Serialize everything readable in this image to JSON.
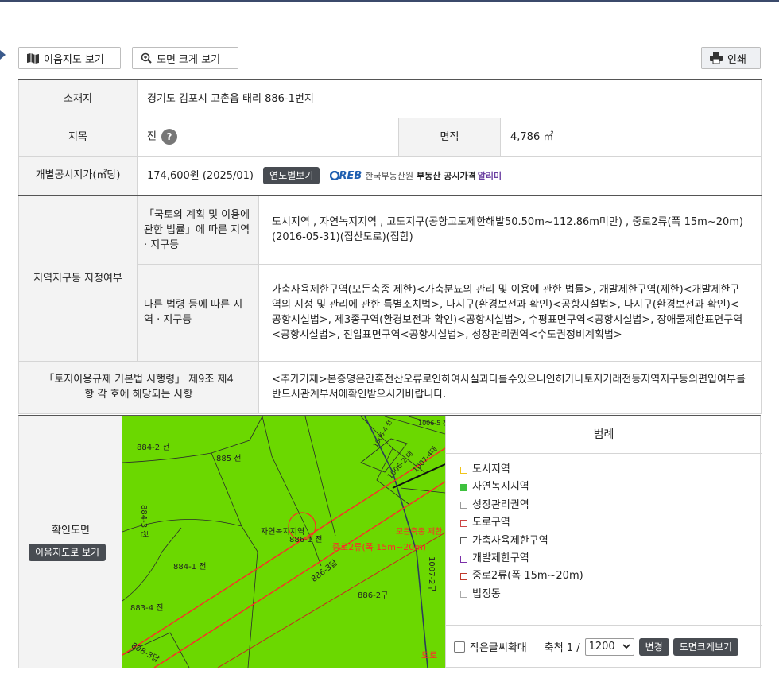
{
  "toolbar": {
    "land_use_map_label": "이음지도 보기",
    "enlarge_label": "도면 크게 보기",
    "print_label": "인쇄"
  },
  "info": {
    "location_label": "소재지",
    "location_value": "경기도 김포시 고촌읍 태리 886-1번지",
    "category_label": "지목",
    "category_value": "전",
    "help_glyph": "?",
    "area_label": "면적",
    "area_value": "4,786 ㎡",
    "price_label": "개별공시지가(㎡당)",
    "price_value": "174,600원 (2025/01)",
    "yearly_button": "연도별보기",
    "reb_logo": "REB",
    "reb_org": "한국부동산원",
    "reb_service": "부동산 공시가격",
    "reb_brand": "알리미"
  },
  "zoning": {
    "label": "지역지구등 지정여부",
    "national_law_label": "「국토의 계획 및 이용에 관한 법률」에 따른 지역 · 지구등",
    "national_law_value": "도시지역 , 자연녹지지역 , 고도지구(공항고도제한해발50.50m~112.86m미만) , 중로2류(폭 15m~20m)(2016-05-31)(집산도로)(접함)",
    "other_law_label": "다른 법령 등에 따른 지역 · 지구등",
    "other_law_value": "가축사육제한구역(모든축종 제한)<가축분뇨의 관리 및 이용에 관한 법률>, 개발제한구역(제한)<개발제한구역의 지정 및 관리에 관한 특별조치법>, 나지구(환경보전과 확인)<공항시설법>, 다지구(환경보전과 확인)<공항시설법>, 제3종구역(환경보전과 확인)<공항시설법>, 수평표면구역<공항시설법>, 장애물제한표면구역<공항시설법>, 진입표면구역<공항시설법>, 성장관리권역<수도권정비계획법>"
  },
  "regulation": {
    "label": "「토지이용규제 기본법 시행령」 제9조 제4항 각 호에 해당되는 사항",
    "value": "<추가기재>본증명은간혹전산오류로인하여사실과다를수있으니인허가나토지거래전등지역지구등의편입여부를반드시관계부서에확인받으시기바랍니다."
  },
  "map": {
    "label": "확인도면",
    "button": "이음지도로 보기",
    "parcels": [
      "884-2 전",
      "885 전",
      "884-3 전",
      "884-1 전",
      "883-4 전",
      "898-3답",
      "886-1 전",
      "886-3답",
      "886-2구",
      "1007-2구",
      "1006-4 천",
      "1006-2 대",
      "1007-4대",
      "1006-5 천"
    ],
    "overlay_label": "자연녹지지역",
    "road_label": "중로2류(폭 15m~20m)",
    "restriction_label": "모든축종 제한",
    "road_area_label": "도로"
  },
  "legend": {
    "title": "범례",
    "items": [
      {
        "label": "도시지역",
        "color": "#f0c419",
        "filled": false
      },
      {
        "label": "자연녹지지역",
        "color": "#3ec13e",
        "filled": true
      },
      {
        "label": "성장관리권역",
        "color": "#999999",
        "filled": false
      },
      {
        "label": "도로구역",
        "color": "#cc4444",
        "filled": false
      },
      {
        "label": "가축사육제한구역",
        "color": "#555555",
        "filled": false
      },
      {
        "label": "개발제한구역",
        "color": "#7b2fa8",
        "filled": false
      },
      {
        "label": "중로2류(폭 15m~20m)",
        "color": "#c0392b",
        "filled": false
      },
      {
        "label": "법정동",
        "color": "#aaaaaa",
        "filled": false
      }
    ]
  },
  "controls": {
    "small_text_label": "작은글씨확대",
    "scale_label": "축척 1 /",
    "scale_value": "1200",
    "change_button": "변경",
    "enlarge_button": "도면크게보기"
  }
}
